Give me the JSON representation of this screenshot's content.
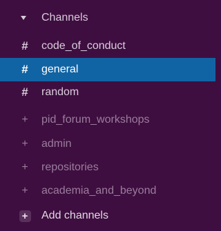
{
  "section": {
    "title": "Channels"
  },
  "channels": [
    {
      "prefix": "#",
      "name": "code_of_conduct"
    },
    {
      "prefix": "#",
      "name": "general"
    },
    {
      "prefix": "#",
      "name": "random"
    },
    {
      "prefix": "+",
      "name": "pid_forum_workshops"
    },
    {
      "prefix": "+",
      "name": "admin"
    },
    {
      "prefix": "+",
      "name": "repositories"
    },
    {
      "prefix": "+",
      "name": "academia_and_beyond"
    }
  ],
  "add_channels": {
    "prefix": "+",
    "label": "Add channels"
  },
  "colors": {
    "sidebar_bg": "#3f0e40",
    "active_bg": "#1164a3"
  }
}
